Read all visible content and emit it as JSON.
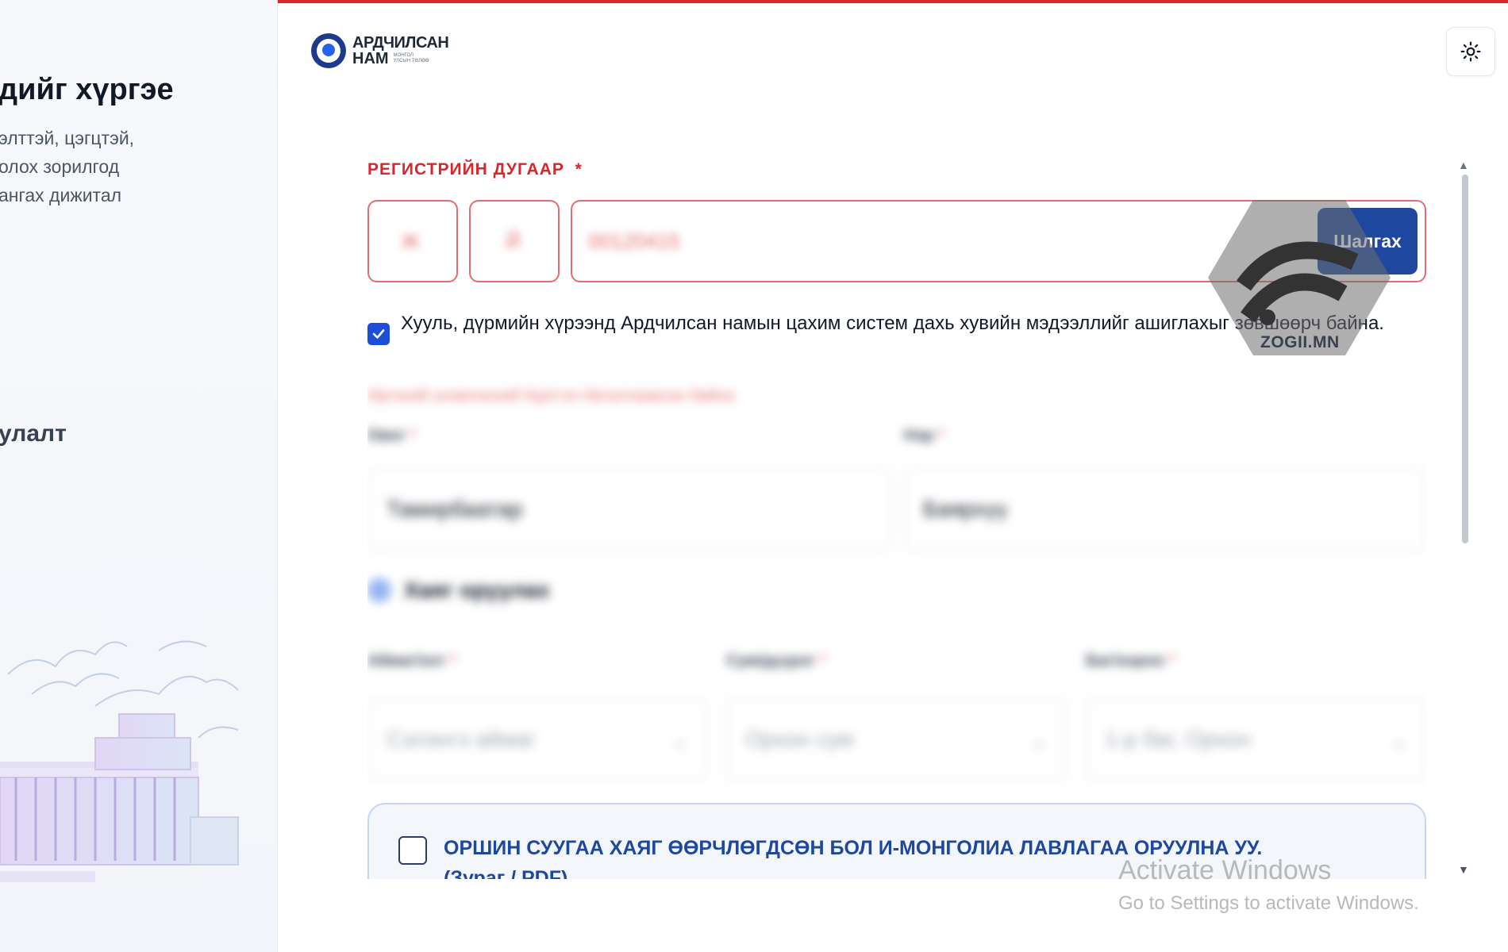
{
  "hero": {
    "title": "дийг хүргэе",
    "description_lines": [
      "элттэй, цэгцтэй,",
      "олох зорилгод",
      "ангах дижитал"
    ],
    "subtitle": "улалт"
  },
  "header": {
    "logo_line1": "АРДЧИЛСАН",
    "logo_line2": "НАМ",
    "logo_small": "МОНГОЛ УЛСЫН ТӨЛӨӨ",
    "theme_toggle_icon": "sun-icon"
  },
  "form": {
    "register_label": "РЕГИСТРИЙН ДУГААР",
    "required_mark": "*",
    "register_letter1": "Ж",
    "register_letter2": "Й",
    "register_digits": "00120415",
    "check_button": "Шалгах",
    "consent_text": "Хууль, дүрмийн хүрээнд Ардчилсан намын цахим систем дахь хувийн мэдээллийг ашиглахыг зөвшөөрч байна.",
    "consent_checked": true,
    "error_text": "Иргэний үнэмлэхний бүртгэл баталгаажсан байна",
    "lastname_label": "Овог",
    "lastname_value": "Тамирбаатар",
    "firstname_label": "Нэр",
    "firstname_value": "Баярхүү",
    "address_title": "Хаяг оруулах",
    "aimag_label": "Аймаг/хот",
    "aimag_value": "Сэлэнгэ аймаг",
    "sum_label": "Сум/дүүрэг",
    "sum_value": "Орхон сум",
    "bag_label": "Баг/хороо",
    "bag_value": "1-р баг, Орхон",
    "notice_text": "ОРШИН СУУГАА ХАЯГ ӨӨРЧЛӨГДСӨН БОЛ И-МОНГОЛИА ЛАВЛАГАА ОРУУЛНА УУ.",
    "notice_sub": "(Зураг / PDF)"
  },
  "watermark": {
    "text": "ZOGII.MN"
  },
  "os_overlay": {
    "title": "Activate Windows",
    "subtitle": "Go to Settings to activate Windows."
  },
  "colors": {
    "brand_red": "#d9252b",
    "brand_blue": "#1e47a0"
  }
}
